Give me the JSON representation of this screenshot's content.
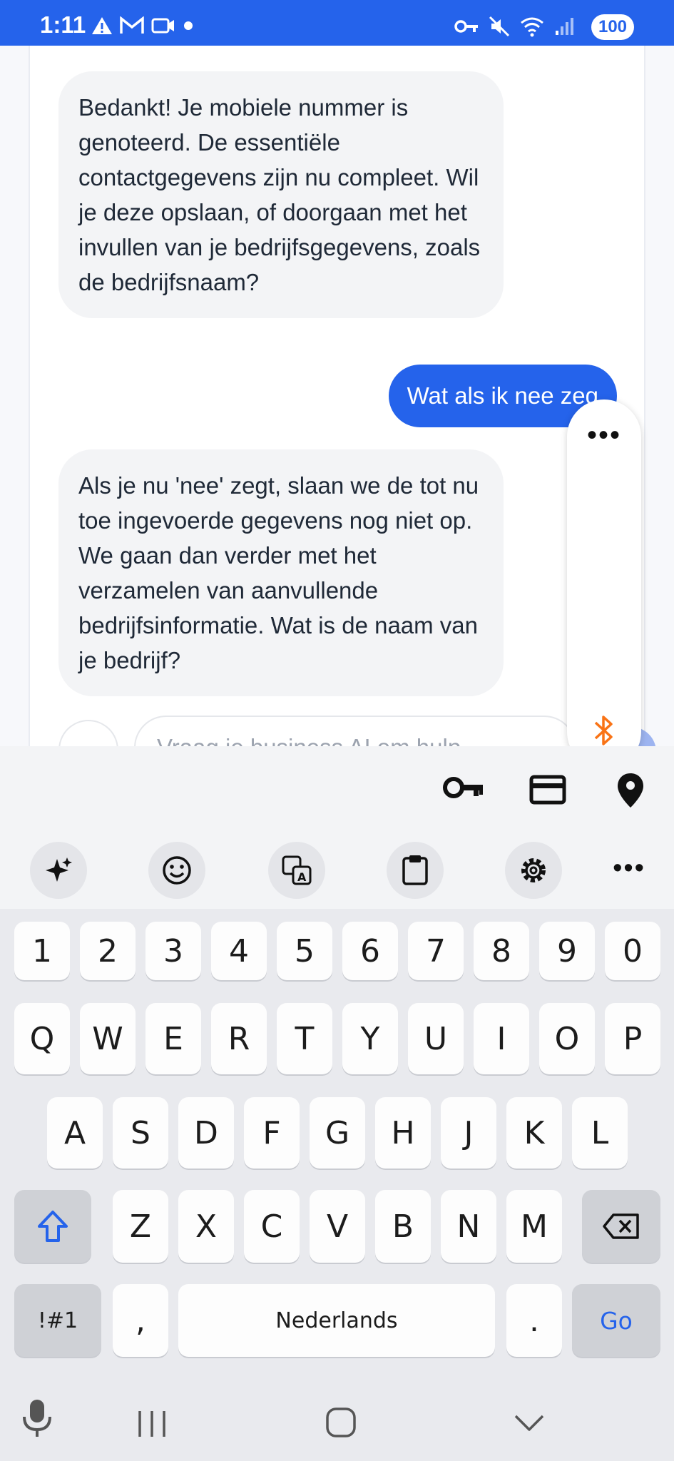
{
  "status_bar": {
    "time": "1:11",
    "battery": "100",
    "left_icons": [
      "warning-icon",
      "gmail-icon",
      "videocall-icon",
      "dot-icon"
    ],
    "right_icons": [
      "key-icon",
      "mute-icon",
      "wifi-icon",
      "signal-icon"
    ]
  },
  "chat": {
    "messages": [
      {
        "role": "bot",
        "text": "Bedankt! Je mobiele nummer is genoteerd. De essentiële contactgegevens zijn nu compleet. Wil je deze opslaan, of doorgaan met het invullen van je bedrijfsgegevens, zoals de bedrijfsnaam?"
      },
      {
        "role": "user",
        "text": "Wat als ik nee zeg"
      },
      {
        "role": "bot",
        "text": "Als je nu 'nee' zegt, slaan we de tot nu toe ingevoerde gegevens nog niet op. We gaan dan verder met het verzamelen van aanvullende bedrijfsinformatie. Wat is de naam van je bedrijf?"
      }
    ],
    "input_placeholder": "Vraag je business AI om hulp"
  },
  "keyboard": {
    "number_row": [
      "1",
      "2",
      "3",
      "4",
      "5",
      "6",
      "7",
      "8",
      "9",
      "0"
    ],
    "row1": [
      "Q",
      "W",
      "E",
      "R",
      "T",
      "Y",
      "U",
      "I",
      "O",
      "P"
    ],
    "row2": [
      "A",
      "S",
      "D",
      "F",
      "G",
      "H",
      "J",
      "K",
      "L"
    ],
    "row3": [
      "Z",
      "X",
      "C",
      "V",
      "B",
      "N",
      "M"
    ],
    "symbols_label": "!#1",
    "comma": ",",
    "space_label": "Nederlands",
    "period": ".",
    "go_label": "Go",
    "accent_color": "#2563eb"
  },
  "colors": {
    "primary": "#2563eb",
    "bubble_bot": "#f3f4f6",
    "bluetooth": "#f97316"
  }
}
